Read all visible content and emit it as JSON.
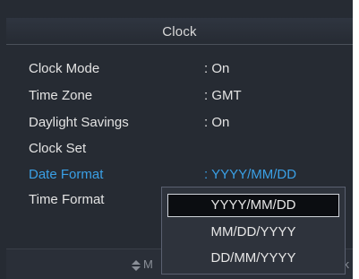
{
  "header": {
    "title": "Clock"
  },
  "menu": [
    {
      "label": "Clock Mode",
      "value": ": On"
    },
    {
      "label": "Time Zone",
      "value": ": GMT"
    },
    {
      "label": "Daylight Savings",
      "value": ": On"
    },
    {
      "label": "Clock Set",
      "value": ""
    },
    {
      "label": "Date Format",
      "value": ": YYYY/MM/DD",
      "active": true
    },
    {
      "label": "Time Format",
      "value": ""
    }
  ],
  "dropdown": {
    "selected": "YYYY/MM/DD",
    "options": [
      "YYYY/MM/DD",
      "MM/DD/YYYY",
      "DD/MM/YYYY"
    ]
  },
  "footer": {
    "hint": "M",
    "right_hint": "k",
    "icons": [
      "updown-icon"
    ]
  },
  "colors": {
    "background": "#262b33",
    "text": "#e3e3e3",
    "accent": "#3aa0e6",
    "selected_option_bg": "#0b0d11"
  }
}
